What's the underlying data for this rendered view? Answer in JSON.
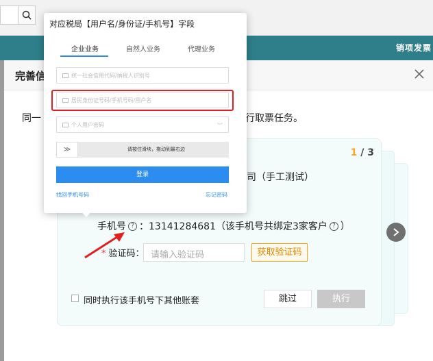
{
  "background": {
    "header_right_text": "销项发票"
  },
  "dialog": {
    "title": "完善信",
    "description_left": "同一",
    "description_right": "行取票任务。",
    "card": {
      "page_current": "1",
      "page_total": "/ 3",
      "company_text": "公司（手工测试）",
      "phone_label": "手机号",
      "phone_colon": "：",
      "phone_value": "13141284681（该手机号共绑定3家客户",
      "phone_close": "）",
      "code_required": "*",
      "code_label": "验证码：",
      "code_placeholder": "请输入验证码",
      "get_code_button": "获取验证码",
      "checkbox_label": "同时执行该手机号下其他账套",
      "skip_button": "跳过",
      "execute_button": "执行"
    }
  },
  "popup": {
    "title": "对应税局【用户名/身份证/手机号】字段",
    "tabs": [
      "企业业务",
      "自然人业务",
      "代理业务"
    ],
    "fields": {
      "credit_code_placeholder": "统一社会信用代码/纳税人识别号",
      "id_placeholder": "居民身份证号码/手机号码/用户名",
      "password_placeholder": "个人用户密码"
    },
    "slider_text": "请按住滑块，拖动到最右边",
    "slider_handle": "≫",
    "login_button": "登录",
    "find_phone_link": "找回手机号码",
    "forgot_password_link": "忘记密码"
  },
  "colors": {
    "teal_bar": "#2e7f8a",
    "primary_blue": "#2d8cf0",
    "highlight_red": "#e02020",
    "accent_orange": "#f5a623"
  }
}
